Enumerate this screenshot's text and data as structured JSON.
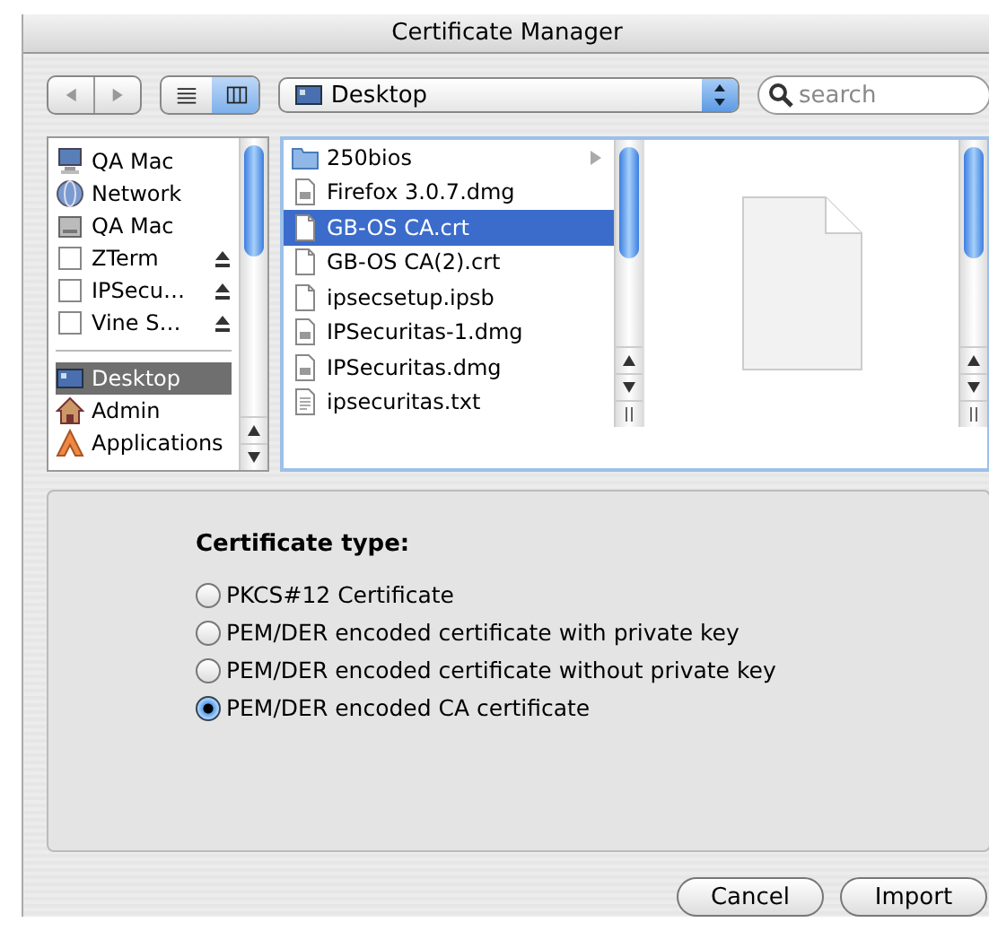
{
  "window": {
    "title": "Certificate Manager"
  },
  "toolbar": {
    "location": "Desktop",
    "search": {
      "placeholder": "search"
    },
    "view_modes": [
      {
        "kind": "list",
        "selected": false
      },
      {
        "kind": "columns",
        "selected": true
      }
    ]
  },
  "sidebar": {
    "items": [
      {
        "label": "QA Mac",
        "kind": "computer",
        "eject": false,
        "selected": false
      },
      {
        "label": "Network",
        "kind": "network",
        "eject": false,
        "selected": false
      },
      {
        "label": "QA Mac",
        "kind": "disk",
        "eject": false,
        "selected": false
      },
      {
        "label": "ZTerm",
        "kind": "volume",
        "eject": true,
        "selected": false
      },
      {
        "label": "IPSecu…",
        "kind": "volume",
        "eject": true,
        "selected": false
      },
      {
        "label": "Vine S…",
        "kind": "volume",
        "eject": true,
        "selected": false
      },
      {
        "label": "Desktop",
        "kind": "desktop",
        "eject": false,
        "selected": true,
        "separator_before": true
      },
      {
        "label": "Admin",
        "kind": "home",
        "eject": false,
        "selected": false
      },
      {
        "label": "Applications",
        "kind": "apps",
        "eject": false,
        "selected": false
      }
    ]
  },
  "files": [
    {
      "name": "250bios",
      "kind": "folder",
      "selected": false
    },
    {
      "name": "Firefox 3.0.7.dmg",
      "kind": "dmg",
      "selected": false
    },
    {
      "name": "GB-OS CA.crt",
      "kind": "doc",
      "selected": true
    },
    {
      "name": "GB-OS CA(2).crt",
      "kind": "doc",
      "selected": false
    },
    {
      "name": "ipsecsetup.ipsb",
      "kind": "doc",
      "selected": false
    },
    {
      "name": "IPSecuritas-1.dmg",
      "kind": "dmg",
      "selected": false
    },
    {
      "name": "IPSecuritas.dmg",
      "kind": "dmg",
      "selected": false
    },
    {
      "name": "ipsecuritas.txt",
      "kind": "text",
      "selected": false
    }
  ],
  "certificate_type": {
    "label": "Certificate type:",
    "options": [
      {
        "label": "PKCS#12 Certificate",
        "selected": false
      },
      {
        "label": "PEM/DER encoded certificate with private key",
        "selected": false
      },
      {
        "label": "PEM/DER encoded certificate without private key",
        "selected": false
      },
      {
        "label": "PEM/DER encoded CA certificate",
        "selected": true
      }
    ]
  },
  "buttons": [
    "Cancel",
    "Import"
  ]
}
